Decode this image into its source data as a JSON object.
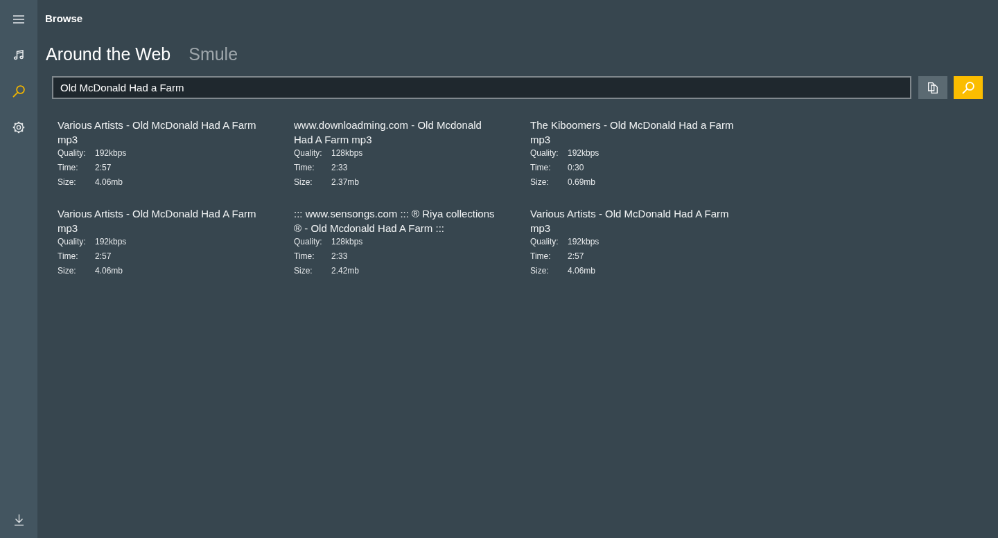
{
  "header": {
    "title": "Browse"
  },
  "sidebar": {
    "items": [
      {
        "kind": "music",
        "selected": false
      },
      {
        "kind": "search",
        "selected": true
      },
      {
        "kind": "settings",
        "selected": false
      }
    ]
  },
  "tabs": [
    {
      "label": "Around the Web",
      "selected": true
    },
    {
      "label": "Smule",
      "selected": false
    }
  ],
  "search": {
    "value": "Old McDonald Had a Farm"
  },
  "results": [
    {
      "title": "Various Artists - Old McDonald Had A Farm mp3",
      "details": [
        {
          "label": "Quality:",
          "value": "192kbps"
        },
        {
          "label": "Time:",
          "value": "2:57"
        },
        {
          "label": "Size:",
          "value": "4.06mb"
        }
      ]
    },
    {
      "title": "www.downloadming.com - Old Mcdonald Had A Farm mp3",
      "details": [
        {
          "label": "Quality:",
          "value": "128kbps"
        },
        {
          "label": "Time:",
          "value": "2:33"
        },
        {
          "label": "Size:",
          "value": "2.37mb"
        }
      ]
    },
    {
      "title": "The Kiboomers - Old McDonald Had a Farm mp3",
      "details": [
        {
          "label": "Quality:",
          "value": "192kbps"
        },
        {
          "label": "Time:",
          "value": "0:30"
        },
        {
          "label": "Size:",
          "value": "0.69mb"
        }
      ]
    },
    {
      "title": "Various Artists - Old McDonald Had A Farm mp3",
      "details": [
        {
          "label": "Quality:",
          "value": "192kbps"
        },
        {
          "label": "Time:",
          "value": "2:57"
        },
        {
          "label": "Size:",
          "value": "4.06mb"
        }
      ]
    },
    {
      "title": "::: www.sensongs.com ::: ® Riya collections ® - Old Mcdonald Had A Farm :::",
      "details": [
        {
          "label": "Quality:",
          "value": "128kbps"
        },
        {
          "label": "Time:",
          "value": "2:33"
        },
        {
          "label": "Size:",
          "value": "2.42mb"
        }
      ]
    },
    {
      "title": "Various Artists - Old McDonald Had A Farm mp3",
      "details": [
        {
          "label": "Quality:",
          "value": "192kbps"
        },
        {
          "label": "Time:",
          "value": "2:57"
        },
        {
          "label": "Size:",
          "value": "4.06mb"
        }
      ]
    }
  ]
}
